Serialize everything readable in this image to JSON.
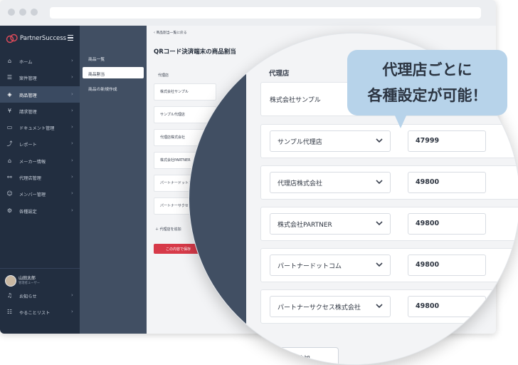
{
  "app": {
    "name": "PartnerSuccess"
  },
  "sidebar": {
    "items": [
      {
        "label": "ホーム",
        "icon": "home-icon"
      },
      {
        "label": "案件管理",
        "icon": "list-icon"
      },
      {
        "label": "商品管理",
        "icon": "box-icon",
        "active": true
      },
      {
        "label": "請求管理",
        "icon": "yen-icon"
      },
      {
        "label": "ドキュメント管理",
        "icon": "folder-icon"
      },
      {
        "label": "レポート",
        "icon": "chart-icon"
      },
      {
        "label": "メーカー情報",
        "icon": "store-icon"
      },
      {
        "label": "代理店管理",
        "icon": "handshake-icon"
      },
      {
        "label": "メンバー管理",
        "icon": "people-icon"
      },
      {
        "label": "各種設定",
        "icon": "gear-icon"
      }
    ],
    "user": {
      "name": "山田太郎",
      "role": "管理者ユーザー"
    },
    "bottom": [
      {
        "label": "お知らせ",
        "icon": "bell-icon"
      },
      {
        "label": "やることリスト",
        "icon": "checklist-icon"
      }
    ]
  },
  "subnav": {
    "items": [
      {
        "label": "商品一覧"
      },
      {
        "label": "商品割当",
        "active": true
      },
      {
        "label": "商品の新規作成"
      }
    ]
  },
  "main": {
    "back_link": "商品割当一覧に戻る",
    "title": "QRコード決済端末の商品割当",
    "section_label": "代理店",
    "rows": [
      "株式会社サンプル",
      "サンプル代理店",
      "代理店株式会社",
      "株式会社PARTNER",
      "パートナードットコム",
      "パートナーサクセス株式会社"
    ],
    "add_label": "代理店を追加",
    "save_label": "この内容で保存"
  },
  "magnifier": {
    "label": "代理店",
    "first_row": "株式会社サンプル",
    "rows": [
      {
        "agent": "サンプル代理店",
        "value": "47999"
      },
      {
        "agent": "代理店株式会社",
        "value": "49800"
      },
      {
        "agent": "株式会社PARTNER",
        "value": "49800"
      },
      {
        "agent": "パートナードットコム",
        "value": "49800"
      },
      {
        "agent": "パートナーサクセス株式会社",
        "value": "49800"
      }
    ],
    "add_label": "＋ を追加"
  },
  "callout": {
    "line1": "代理店ごとに",
    "line2": "各種設定が可能！"
  },
  "colors": {
    "sidebar": "#222e40",
    "subnav": "#414f63",
    "accent_red": "#d73a49",
    "callout": "#b7d3ea"
  }
}
